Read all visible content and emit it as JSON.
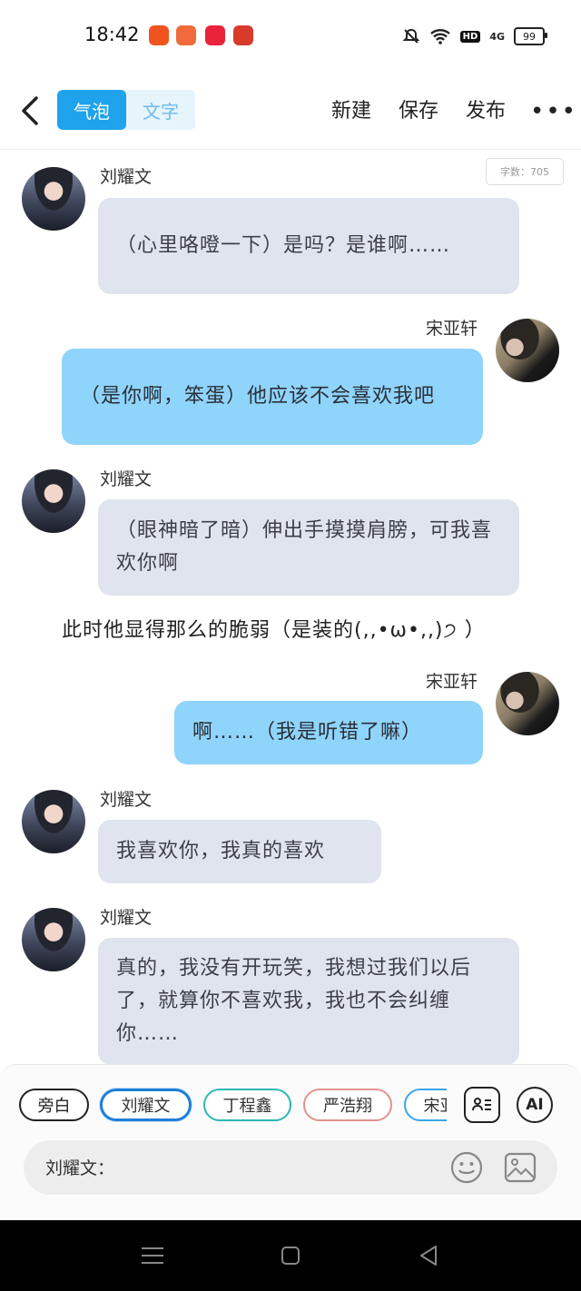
{
  "status": {
    "time": "18:42",
    "hd": "HD",
    "net": "4G",
    "battery": "99"
  },
  "header": {
    "tabs": [
      {
        "label": "气泡",
        "active": true
      },
      {
        "label": "文字",
        "active": false
      }
    ],
    "actions": {
      "new": "新建",
      "save": "保存",
      "publish": "发布",
      "more": "•••"
    }
  },
  "counter": "字数：705",
  "messages": [
    {
      "side": "left",
      "name": "刘耀文",
      "text": "（心里咯噔一下）是吗？是谁啊……"
    },
    {
      "side": "right",
      "name": "宋亚轩",
      "text": "（是你啊，笨蛋）他应该不会喜欢我吧"
    },
    {
      "side": "left",
      "name": "刘耀文",
      "text": "（眼神暗了暗）伸出手摸摸肩膀，可我喜欢你啊"
    },
    {
      "side": "narration",
      "text": "此时他显得那么的脆弱（是装的(,,•ω•,,)੭ ）"
    },
    {
      "side": "right",
      "name": "宋亚轩",
      "text": "啊……（我是听错了嘛）"
    },
    {
      "side": "left",
      "name": "刘耀文",
      "text": "我喜欢你，我真的喜欢"
    },
    {
      "side": "left",
      "name": "刘耀文",
      "text": "真的，我没有开玩笑，我想过我们以后了，就算你不喜欢我，我也不会纠缠你……"
    }
  ],
  "roles": [
    {
      "label": "旁白",
      "color": "#222222",
      "selected": false
    },
    {
      "label": "刘耀文",
      "color": "#1e7fd8",
      "selected": true
    },
    {
      "label": "丁程鑫",
      "color": "#2bb7b0",
      "selected": false
    },
    {
      "label": "严浩翔",
      "color": "#e2928f",
      "selected": false
    },
    {
      "label": "宋亚轩",
      "color": "#3aa6e6",
      "selected": false
    }
  ],
  "tools": {
    "ai": "AI",
    "cast": "role-card-icon"
  },
  "input": {
    "prefix": "刘耀文："
  },
  "colors": {
    "accent": "#1ea3ec",
    "left_bubble": "#dfe4ee",
    "right_bubble": "#8fd4fb"
  }
}
